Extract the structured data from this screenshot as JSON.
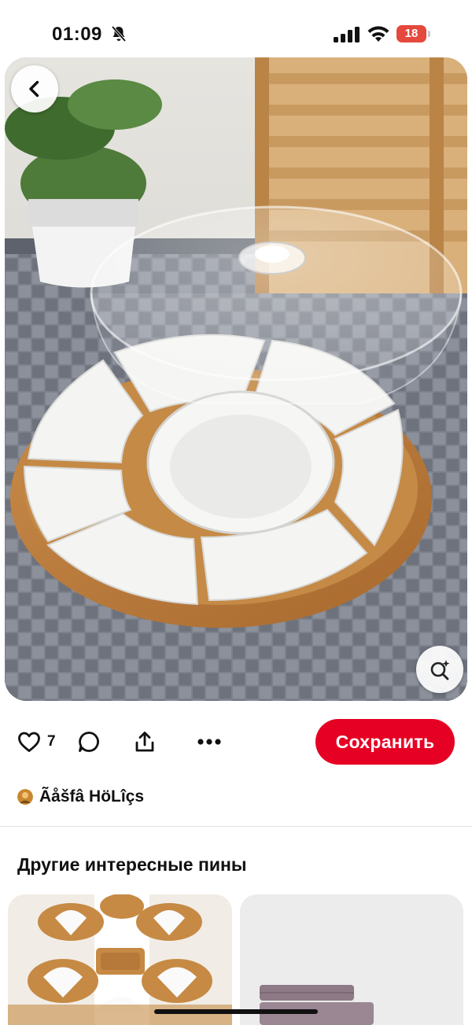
{
  "status_bar": {
    "time": "01:09",
    "battery_level": "18",
    "battery_color": "#e5483c"
  },
  "pin": {
    "image_alt": "Lazy susan serving platter with glass dome lid",
    "back_icon": "chevron-left-icon",
    "lens_icon": "visual-search-icon"
  },
  "actions": {
    "like_icon": "heart-icon",
    "like_count": "7",
    "comment_icon": "comment-icon",
    "share_icon": "share-icon",
    "more_icon": "more-icon",
    "save_label": "Сохранить",
    "save_color": "#e60023"
  },
  "author": {
    "name": "Ãåšfâ HöLîçs"
  },
  "more_pins": {
    "title": "Другие интересные пины"
  }
}
